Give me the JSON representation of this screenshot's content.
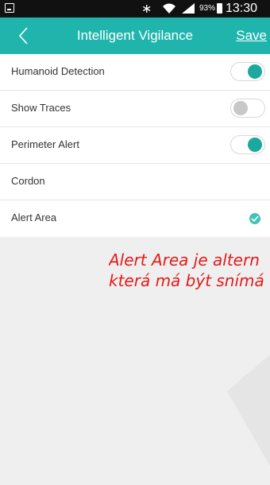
{
  "status_bar": {
    "battery_percent": "93%",
    "time": "13:30",
    "icons": [
      "gallery-icon",
      "bluetooth-icon",
      "wifi-icon",
      "signal-icon",
      "battery-icon"
    ]
  },
  "app_bar": {
    "title": "Intelligent Vigilance",
    "save_label": "Save",
    "back_icon": "chevron-left-icon",
    "background_color": "#1fb5ad"
  },
  "settings": [
    {
      "label": "Humanoid Detection",
      "control": "toggle",
      "on": true
    },
    {
      "label": "Show Traces",
      "control": "toggle",
      "on": false
    },
    {
      "label": "Perimeter Alert",
      "control": "toggle",
      "on": true
    },
    {
      "label": "Cordon",
      "control": "none"
    },
    {
      "label": "Alert Area",
      "control": "check",
      "checked": true
    }
  ],
  "annotation": {
    "line1": "Alert Area je altern",
    "line2": "která má být snímá",
    "color": "#e31b1b"
  }
}
